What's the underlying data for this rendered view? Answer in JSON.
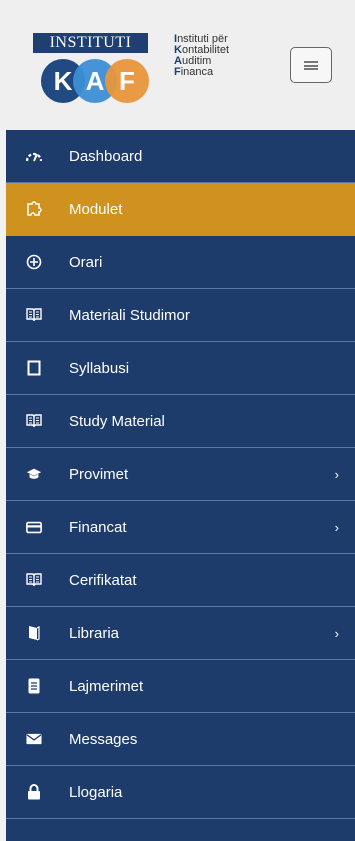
{
  "header": {
    "logo_title": "INSTITUTI",
    "logo_letters": [
      "K",
      "A",
      "F"
    ],
    "logo_lines": [
      {
        "first": "I",
        "rest": "nstituti për"
      },
      {
        "first": "K",
        "rest": "ontabilitet"
      },
      {
        "first": "A",
        "rest": "uditim"
      },
      {
        "first": "F",
        "rest": "inanca"
      }
    ],
    "menu_toggle_icon": "hamburger-icon"
  },
  "sidebar": {
    "items": [
      {
        "label": "Dashboard",
        "icon": "speedometer-icon",
        "active": false,
        "has_submenu": false
      },
      {
        "label": "Modulet",
        "icon": "puzzle-icon",
        "active": true,
        "has_submenu": false
      },
      {
        "label": "Orari",
        "icon": "compass-icon",
        "active": false,
        "has_submenu": false
      },
      {
        "label": "Materiali Studimor",
        "icon": "book-open-icon",
        "active": false,
        "has_submenu": false
      },
      {
        "label": "Syllabusi",
        "icon": "square-icon",
        "active": false,
        "has_submenu": false
      },
      {
        "label": "Study Material",
        "icon": "book-open-icon",
        "active": false,
        "has_submenu": false
      },
      {
        "label": "Provimet",
        "icon": "graduation-cap-icon",
        "active": false,
        "has_submenu": true
      },
      {
        "label": "Financat",
        "icon": "credit-card-icon",
        "active": false,
        "has_submenu": true
      },
      {
        "label": "Cerifikatat",
        "icon": "book-open-icon",
        "active": false,
        "has_submenu": false
      },
      {
        "label": "Libraria",
        "icon": "book-icon",
        "active": false,
        "has_submenu": true
      },
      {
        "label": "Lajmerimet",
        "icon": "document-icon",
        "active": false,
        "has_submenu": false
      },
      {
        "label": "Messages",
        "icon": "envelope-icon",
        "active": false,
        "has_submenu": false
      },
      {
        "label": "Llogaria",
        "icon": "lock-icon",
        "active": false,
        "has_submenu": false
      }
    ],
    "chevron": "›"
  },
  "colors": {
    "sidebar_bg": "#1e3c6b",
    "active_bg": "#d0921f",
    "divider": "#5a78a3",
    "header_bg": "#efefef"
  }
}
